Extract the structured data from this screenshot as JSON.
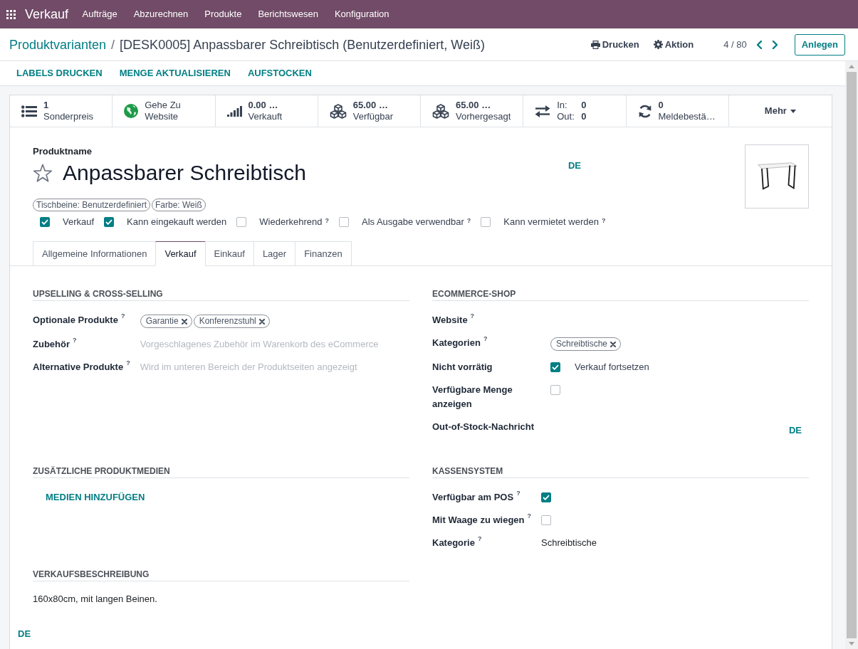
{
  "navbar": {
    "app": "Verkauf",
    "menu": [
      {
        "label": "Aufträge"
      },
      {
        "label": "Abzurechnen"
      },
      {
        "label": "Produkte"
      },
      {
        "label": "Berichtswesen"
      },
      {
        "label": "Konfiguration"
      }
    ]
  },
  "breadcrumb": {
    "parent": "Produktvarianten",
    "separator": "/",
    "current": "[DESK0005] Anpassbarer Schreibtisch (Benutzerdefiniert, Weiß)"
  },
  "actions": [
    {
      "label": "Drucken"
    },
    {
      "label": "Aktion"
    }
  ],
  "pager": {
    "value": "4 / 80"
  },
  "create_button": "Anlegen",
  "toolbar": [
    "LABELS DRUCKEN",
    "MENGE AKTUALISIEREN",
    "AUFSTOCKEN"
  ],
  "stat_buttons": [
    {
      "kind": "stat",
      "value": "1",
      "label": "Sonderpreis"
    },
    {
      "kind": "lines",
      "lines": [
        "Gehe Zu",
        "Website"
      ]
    },
    {
      "kind": "stat",
      "value": "0.00 …",
      "label": "Verkauft"
    },
    {
      "kind": "stat",
      "value": "65.00 …",
      "label": "Verfügbar"
    },
    {
      "kind": "stat",
      "value": "65.00 …",
      "label": "Vorhergesagt"
    },
    {
      "kind": "inout",
      "rows": [
        {
          "label": "In:",
          "value": "0"
        },
        {
          "label": "Out:",
          "value": "0"
        }
      ]
    },
    {
      "kind": "stat",
      "value": "0",
      "label": "Meldebestä…"
    },
    {
      "kind": "more",
      "label": "Mehr"
    }
  ],
  "product": {
    "label": "Produktname",
    "name": "Anpassbarer Schreibtisch",
    "favorite": false,
    "language": "DE",
    "attributes": [
      "Tischbeine: Benutzerdefiniert",
      "Farbe: Weiß"
    ],
    "options": [
      {
        "label": "Verkauf",
        "checked": true
      },
      {
        "label": "Kann eingekauft werden",
        "checked": true
      },
      {
        "label": "Wiederkehrend",
        "help": "?",
        "checked": false
      },
      {
        "label": "Als Ausgabe verwendbar",
        "help": "?",
        "checked": false
      },
      {
        "label": "Kann vermietet werden",
        "help": "?",
        "checked": false
      }
    ]
  },
  "tabs": [
    {
      "label": "Allgemeine Informationen",
      "selected": false
    },
    {
      "label": "Verkauf",
      "selected": true
    },
    {
      "label": "Einkauf",
      "selected": false
    },
    {
      "label": "Lager",
      "selected": false
    },
    {
      "label": "Finanzen",
      "selected": false
    }
  ],
  "sections": [
    {
      "kind": "fields",
      "title": "UPSELLING & CROSS-SELLING",
      "fields": [
        {
          "kind": "tags",
          "label": "Optionale Produkte",
          "help": "?",
          "tags": [
            "Garantie",
            "Konferenzstuhl"
          ]
        },
        {
          "kind": "input",
          "label": "Zubehör",
          "help": "?",
          "placeholder": "Vorgeschlagenes Zubehör im Warenkorb des eCommerce"
        },
        {
          "kind": "input",
          "label": "Alternative Produkte",
          "help": "?",
          "placeholder": "Wird im unteren Bereich der Produktseiten angezeigt"
        }
      ]
    },
    {
      "kind": "fields",
      "title": "ECOMMERCE-SHOP",
      "fields": [
        {
          "kind": "input",
          "label": "Website",
          "help": "?"
        },
        {
          "kind": "tags",
          "label": "Kategorien",
          "help": "?",
          "tags": [
            "Schreibtische"
          ]
        },
        {
          "kind": "checkbox",
          "label": "Nicht vorrätig",
          "checked": true,
          "text": "Verkauf fortsetzen"
        },
        {
          "kind": "checkbox",
          "label": "Verfügbare Menge anzeigen",
          "checked": false
        },
        {
          "kind": "html",
          "label": "Out-of-Stock-Nachricht",
          "language": "DE"
        }
      ]
    },
    {
      "kind": "media",
      "title": "ZUSÄTZLICHE PRODUKTMEDIEN",
      "button": "MEDIEN HINZUFÜGEN"
    },
    {
      "kind": "fields",
      "title": "KASSENSYSTEM",
      "fields": [
        {
          "kind": "checkbox",
          "label": "Verfügbar am POS",
          "help": "?",
          "checked": true
        },
        {
          "kind": "checkbox",
          "label": "Mit Waage zu wiegen",
          "help": "?",
          "checked": false
        },
        {
          "kind": "text",
          "label": "Kategorie",
          "help": "?",
          "value": "Schreibtische"
        }
      ]
    },
    {
      "kind": "description",
      "title": "VERKAUFSBESCHREIBUNG",
      "text": "160x80cm, mit langen Beinen."
    }
  ],
  "footer_language": "DE"
}
